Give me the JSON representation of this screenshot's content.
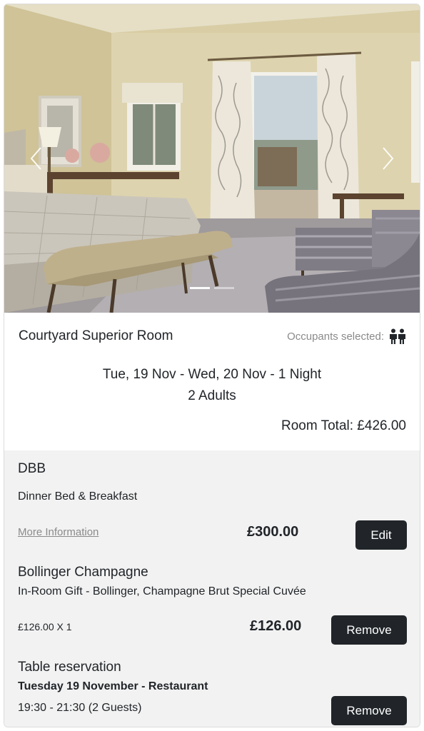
{
  "room": {
    "title": "Courtyard Superior Room",
    "occupants_label": "Occupants selected:",
    "occupants_icon": "people-icon",
    "dates": "Tue, 19 Nov - Wed, 20 Nov - 1 Night",
    "guests": "2 Adults",
    "total": "Room Total: £426.00"
  },
  "carousel": {
    "prev_icon": "chevron-left-icon",
    "next_icon": "chevron-right-icon",
    "slides": 2,
    "active_slide": 1
  },
  "extras": {
    "dbb": {
      "title": "DBB",
      "description": "Dinner Bed & Breakfast",
      "more_info": "More Information",
      "price": "£300.00",
      "button": "Edit"
    },
    "champagne": {
      "title": "Bollinger Champagne",
      "description": "In-Room Gift - Bollinger, Champagne Brut Special Cuvée",
      "quantity": "£126.00 X 1",
      "price": "£126.00",
      "button": "Remove"
    },
    "table": {
      "title": "Table reservation",
      "date": "Tuesday 19 November - Restaurant",
      "time": "19:30 - 21:30 (2 Guests)",
      "button": "Remove"
    }
  },
  "colors": {
    "button_bg": "#212529",
    "extras_bg": "#f2f2f2",
    "muted_text": "#8a8a8a"
  }
}
